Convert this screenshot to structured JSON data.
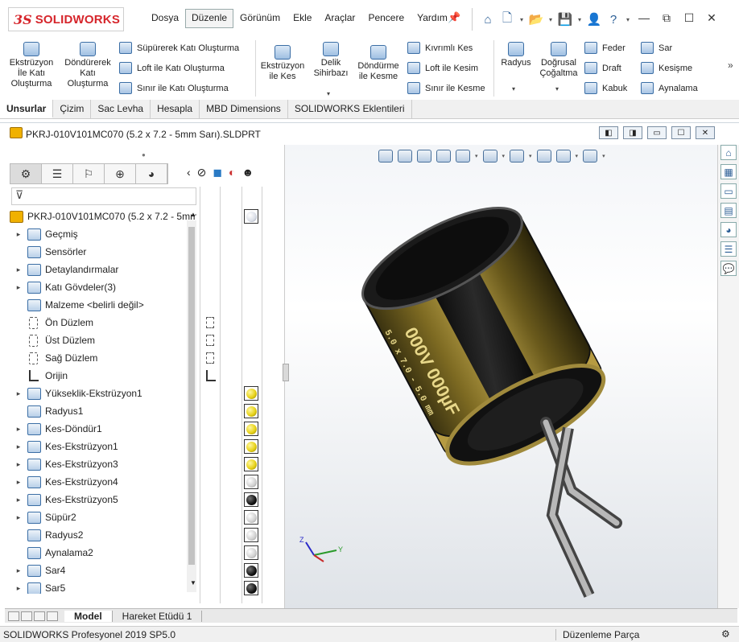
{
  "app": {
    "logo_mark": "3S",
    "logo_text": "SOLIDWORKS"
  },
  "menu": [
    "Dosya",
    "Düzenle",
    "Görünüm",
    "Ekle",
    "Araçlar",
    "Pencere",
    "Yardım"
  ],
  "menu_active": "Düzenle",
  "ribbon": {
    "extrude_boss": "Ekstrüzyon\nİle Katı\nOluşturma",
    "revolve_boss": "Döndürerek\nKatı\nOluşturma",
    "sweep_boss": "Süpürerek Katı Oluşturma",
    "loft_boss": "Loft ile Katı Oluşturma",
    "boundary_boss": "Sınır ile Katı Oluşturma",
    "extrude_cut": "Ekstrüzyon\nile Kes",
    "hole_wizard": "Delik\nSihirbazı",
    "revolve_cut": "Döndürme\nile Kesme",
    "swept_cut": "Kıvrımlı Kes",
    "loft_cut": "Loft ile Kesim",
    "boundary_cut": "Sınır ile Kesme",
    "fillet": "Radyus",
    "linear_pattern": "Doğrusal\nÇoğaltma",
    "rib": "Feder",
    "draft": "Draft",
    "shell": "Kabuk",
    "wrap": "Sar",
    "intersect": "Kesişme",
    "mirror": "Aynalama"
  },
  "command_tabs": [
    "Unsurlar",
    "Çizim",
    "Sac Levha",
    "Hesapla",
    "MBD Dimensions",
    "SOLIDWORKS Eklentileri"
  ],
  "document": {
    "title": "PKRJ-010V101MC070 (5.2 x 7.2 - 5mm Sarı).SLDPRT"
  },
  "tree": {
    "root": "PKRJ-010V101MC070 (5.2 x 7.2 - 5mm",
    "items": [
      {
        "label": "Geçmiş",
        "exp": true,
        "icon": "history-icon"
      },
      {
        "label": "Sensörler",
        "exp": false,
        "icon": "sensor-icon"
      },
      {
        "label": "Detaylandırmalar",
        "exp": true,
        "icon": "annotations-icon"
      },
      {
        "label": "Katı Gövdeler(3)",
        "exp": true,
        "icon": "solid-bodies-icon"
      },
      {
        "label": "Malzeme <belirli değil>",
        "exp": false,
        "icon": "material-icon"
      },
      {
        "label": "Ön Düzlem",
        "exp": false,
        "icon": "plane-icon"
      },
      {
        "label": "Üst Düzlem",
        "exp": false,
        "icon": "plane-icon"
      },
      {
        "label": "Sağ Düzlem",
        "exp": false,
        "icon": "plane-icon"
      },
      {
        "label": "Orijin",
        "exp": false,
        "icon": "origin-icon"
      },
      {
        "label": "Yükseklik-Ekstrüzyon1",
        "exp": true,
        "icon": "extrude-icon"
      },
      {
        "label": "Radyus1",
        "exp": false,
        "icon": "fillet-icon"
      },
      {
        "label": "Kes-Döndür1",
        "exp": true,
        "icon": "revolve-cut-icon"
      },
      {
        "label": "Kes-Ekstrüzyon1",
        "exp": true,
        "icon": "cut-extrude-icon"
      },
      {
        "label": "Kes-Ekstrüzyon3",
        "exp": true,
        "icon": "cut-extrude-icon"
      },
      {
        "label": "Kes-Ekstrüzyon4",
        "exp": true,
        "icon": "cut-extrude-icon"
      },
      {
        "label": "Kes-Ekstrüzyon5",
        "exp": true,
        "icon": "cut-extrude-icon"
      },
      {
        "label": "Süpür2",
        "exp": true,
        "icon": "sweep-icon"
      },
      {
        "label": "Radyus2",
        "exp": false,
        "icon": "fillet-icon"
      },
      {
        "label": "Aynalama2",
        "exp": false,
        "icon": "mirror-icon"
      },
      {
        "label": "Sar4",
        "exp": true,
        "icon": "wrap-icon"
      },
      {
        "label": "Sar5",
        "exp": true,
        "icon": "wrap-icon"
      }
    ]
  },
  "bottom_tabs": [
    "Model",
    "Hareket Etüdü 1"
  ],
  "status": {
    "left": "SOLIDWORKS Profesyonel 2019 SP5.0",
    "right": "Düzenleme Parça"
  },
  "model": {
    "print_value": "000V 000µF",
    "print_size": "5.0 x 7.0 - 5.0 mm",
    "body_color": "#8c7a2a",
    "dark_color": "#141414"
  },
  "colors": {
    "accent": "#d6262c",
    "ribbon_icon": "#3b6ea5",
    "ball_yellow": "#e8d31a"
  }
}
